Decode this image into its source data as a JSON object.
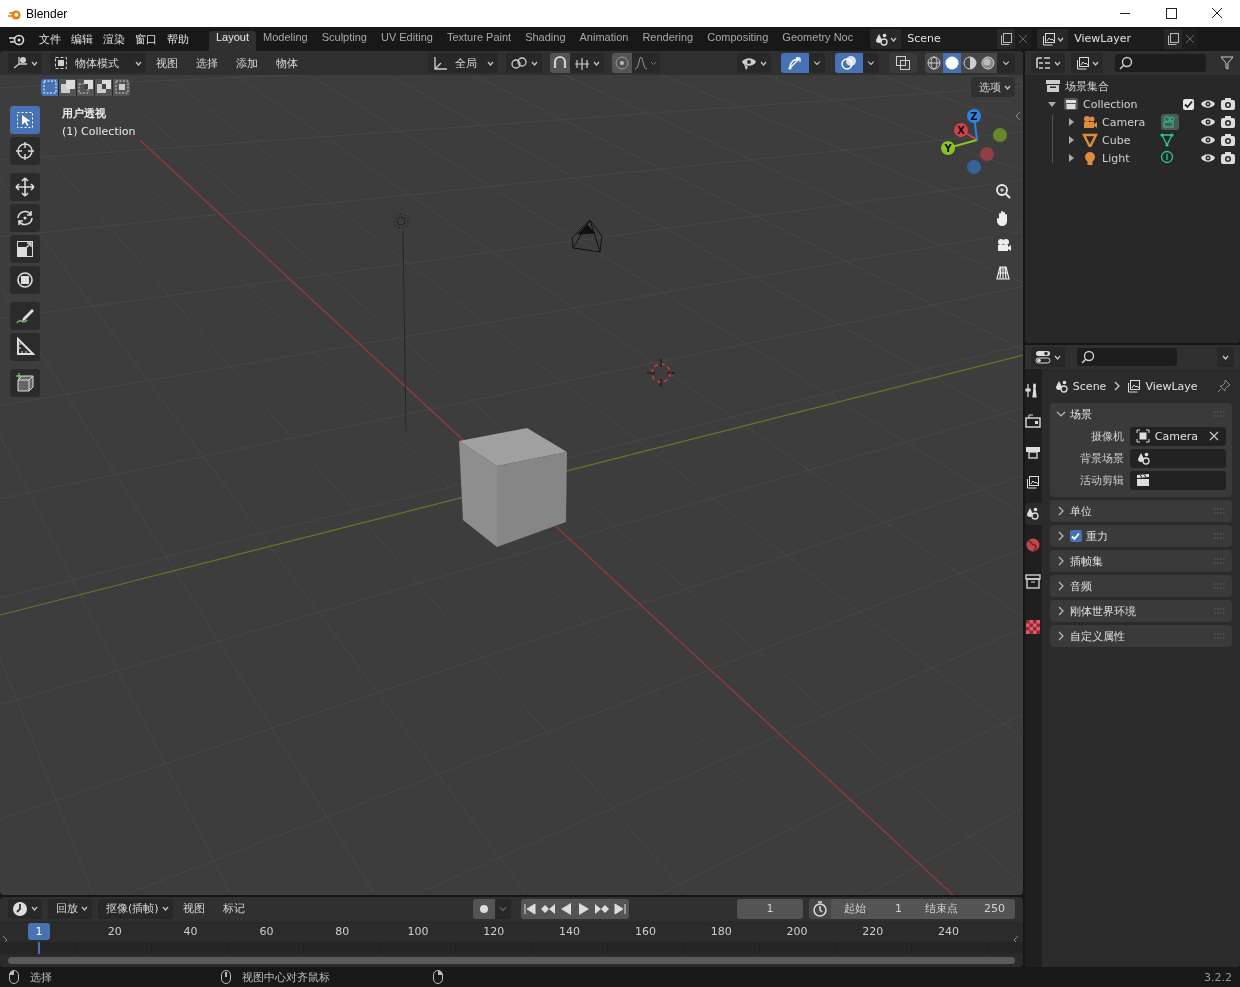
{
  "window": {
    "title": "Blender"
  },
  "topbar": {
    "menus": [
      "文件",
      "编辑",
      "渲染",
      "窗口",
      "帮助"
    ],
    "workspaces": [
      {
        "label": "Layout",
        "selected": true
      },
      {
        "label": "Modeling",
        "selected": false
      },
      {
        "label": "Sculpting",
        "selected": false
      },
      {
        "label": "UV Editing",
        "selected": false
      },
      {
        "label": "Texture Paint",
        "selected": false
      },
      {
        "label": "Shading",
        "selected": false
      },
      {
        "label": "Animation",
        "selected": false
      },
      {
        "label": "Rendering",
        "selected": false
      },
      {
        "label": "Compositing",
        "selected": false
      },
      {
        "label": "Geometry Noc",
        "selected": false
      }
    ],
    "scene": "Scene",
    "view_layer": "ViewLayer"
  },
  "viewport": {
    "mode": "物体模式",
    "menus": [
      "视图",
      "选择",
      "添加",
      "物体"
    ],
    "orientation": "全局",
    "toggles": [
      {
        "kind": "gizmo",
        "on": true
      },
      {
        "kind": "overlay",
        "on": true
      },
      {
        "kind": "xray",
        "on": false
      }
    ],
    "shading": [
      {
        "kind": "wireframe",
        "selected": false
      },
      {
        "kind": "solid",
        "selected": true
      },
      {
        "kind": "material",
        "selected": false
      },
      {
        "kind": "rendered",
        "selected": false
      }
    ],
    "select_modes": [
      {
        "selected": true
      },
      {
        "selected": false
      },
      {
        "selected": false
      },
      {
        "selected": false
      },
      {
        "selected": false
      }
    ],
    "options": "选项",
    "view_name": "用户透视",
    "collection_label": "(1) Collection",
    "tool_groups": [
      [
        {
          "kind": "select",
          "selected": true
        },
        {
          "kind": "cursor",
          "selected": false
        }
      ],
      [
        {
          "kind": "move",
          "selected": false
        },
        {
          "kind": "rotate",
          "selected": false
        },
        {
          "kind": "scale",
          "selected": false
        },
        {
          "kind": "transform",
          "selected": false
        }
      ],
      [
        {
          "kind": "annotate",
          "selected": false
        },
        {
          "kind": "measure",
          "selected": false
        }
      ],
      [
        {
          "kind": "add_cube",
          "selected": false
        }
      ]
    ],
    "gizmo_axes": [
      "X",
      "Y",
      "Z"
    ]
  },
  "outliner": {
    "root": "场景集合",
    "items": [
      {
        "name": "Collection",
        "kind": "collection",
        "expanded": true,
        "checked": true,
        "children": [
          {
            "name": "Camera",
            "kind": "camera",
            "expanded": false
          },
          {
            "name": "Cube",
            "kind": "mesh",
            "expanded": false
          },
          {
            "name": "Light",
            "kind": "light",
            "expanded": false
          }
        ]
      }
    ]
  },
  "properties": {
    "tabs": [
      {
        "kind": "tool",
        "selected": false
      },
      {
        "kind": "render",
        "selected": false
      },
      {
        "kind": "output",
        "selected": false
      },
      {
        "kind": "view_layer",
        "selected": false
      },
      {
        "kind": "scene",
        "selected": true
      },
      {
        "kind": "world",
        "selected": false
      },
      {
        "kind": "collection",
        "selected": false
      },
      {
        "kind": "texture",
        "selected": false
      }
    ],
    "breadcrumb": [
      "Scene",
      "ViewLaye"
    ],
    "panels": [
      {
        "title": "场景",
        "expanded": true,
        "fields": [
          {
            "label": "摄像机",
            "kind": "object",
            "value": "Camera"
          },
          {
            "label": "背景场景",
            "kind": "scene"
          },
          {
            "label": "活动剪辑",
            "kind": "clip"
          }
        ]
      },
      {
        "title": "单位",
        "expanded": false
      },
      {
        "title": "重力",
        "expanded": false,
        "checked": true
      },
      {
        "title": "插帧集",
        "expanded": false
      },
      {
        "title": "音频",
        "expanded": false
      },
      {
        "title": "刚体世界环境",
        "expanded": false
      },
      {
        "title": "自定义属性",
        "expanded": false
      }
    ]
  },
  "timeline": {
    "menus": [
      {
        "label": "回放",
        "kind": "dropdown"
      },
      {
        "label": "抠像(插帧)",
        "kind": "dropdown"
      },
      {
        "label": "视图",
        "kind": "menu"
      },
      {
        "label": "标记",
        "kind": "menu"
      }
    ],
    "current_frame": "1",
    "start": {
      "label": "起始",
      "value": "1"
    },
    "end": {
      "label": "结束点",
      "value": "250"
    },
    "playhead": "1",
    "ticks": [
      "20",
      "40",
      "60",
      "80",
      "100",
      "120",
      "140",
      "160",
      "180",
      "200",
      "220",
      "240"
    ]
  },
  "status_bar": {
    "hints": [
      {
        "kind": "left",
        "label": "选择"
      },
      {
        "kind": "middle",
        "label": "视图中心对齐鼠标"
      },
      {
        "kind": "right"
      }
    ],
    "version": "3.2.2"
  }
}
